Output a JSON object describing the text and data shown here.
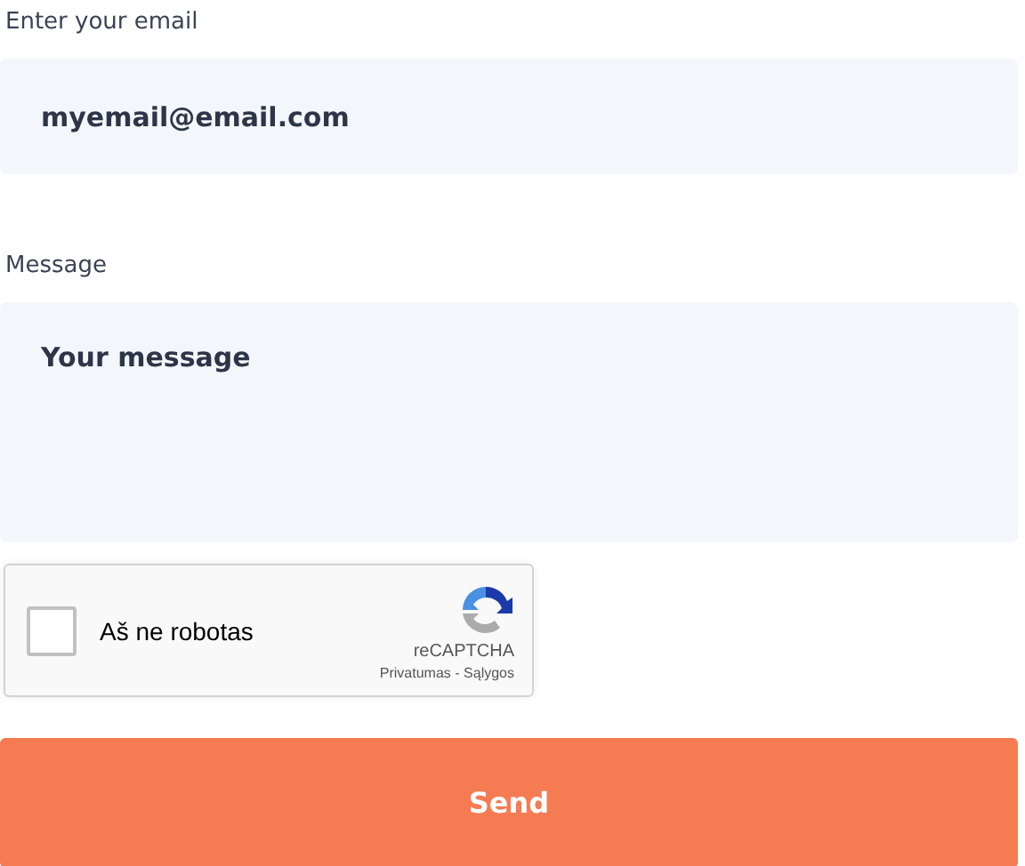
{
  "email": {
    "label": "Enter your email",
    "placeholder": "myemail@email.com"
  },
  "message": {
    "label": "Message",
    "placeholder": "Your message"
  },
  "captcha": {
    "label": "Aš ne robotas",
    "checked": false,
    "brand": "reCAPTCHA",
    "links": "Privatumas - Sąlygos"
  },
  "submit": {
    "label": "Send"
  }
}
